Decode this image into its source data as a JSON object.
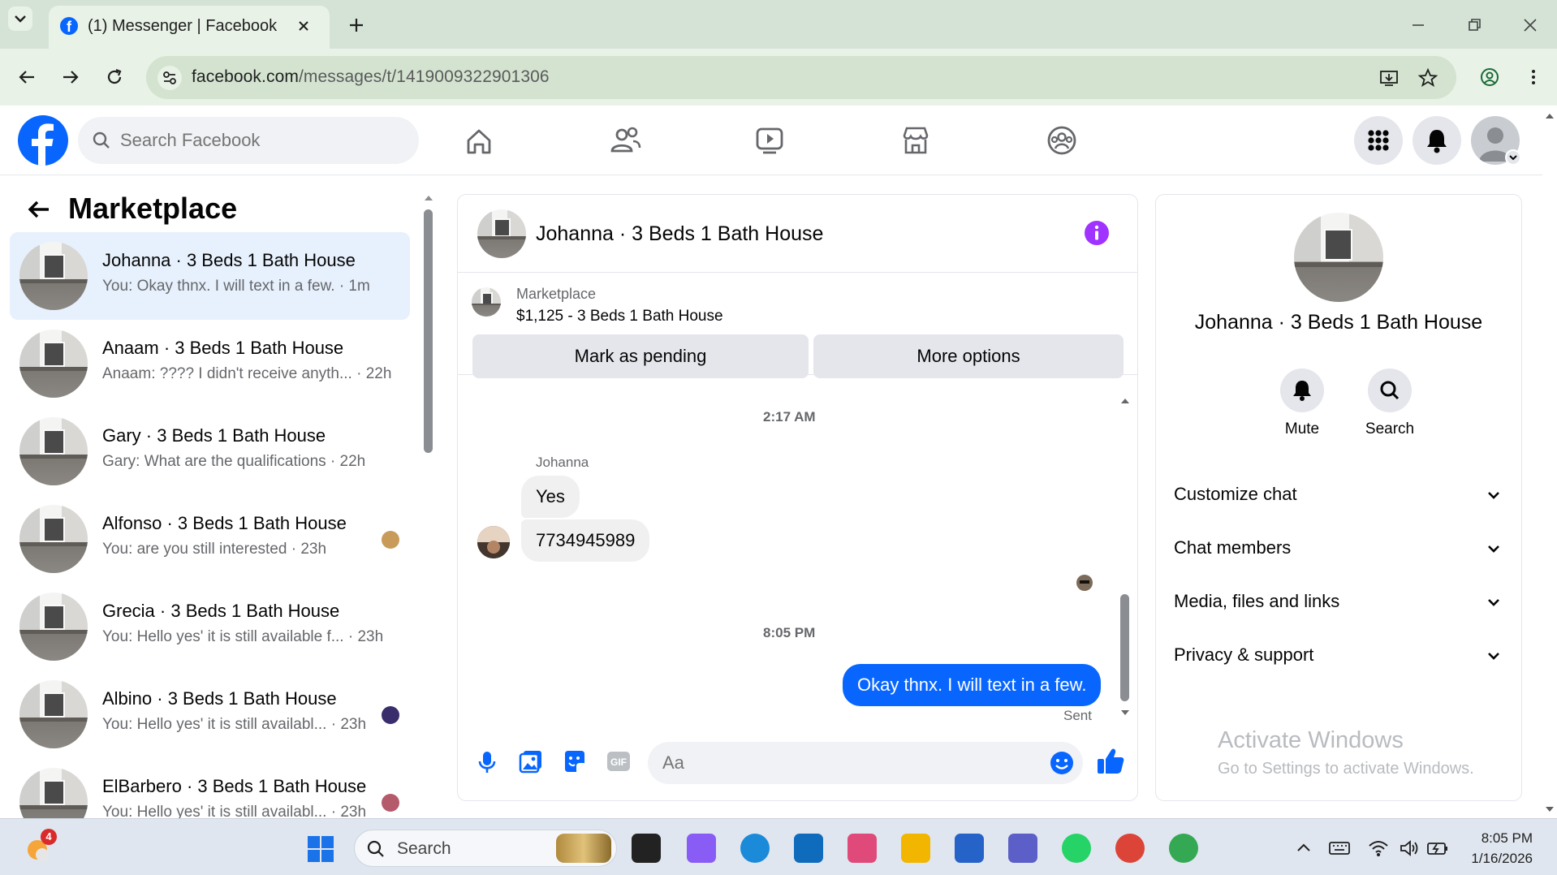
{
  "browser": {
    "tab_title": "(1) Messenger | Facebook",
    "url_host": "facebook.com",
    "url_path": "/messages/t/1419009322901306",
    "icons": [
      "tab-list-icon",
      "facebook-favicon",
      "close-tab-icon",
      "new-tab-icon",
      "minimize-icon",
      "restore-icon",
      "close-window-icon",
      "back-icon",
      "forward-icon",
      "reload-icon",
      "site-info-icon",
      "install-app-icon",
      "bookmark-star-icon",
      "profile-icon",
      "menu-kebab-icon"
    ]
  },
  "fb_header": {
    "search_placeholder": "Search Facebook",
    "nav_icons": [
      "home-icon",
      "friends-icon",
      "watch-icon",
      "marketplace-icon",
      "groups-icon"
    ],
    "right_icons": [
      "menu-grid-icon",
      "notifications-bell-icon",
      "account-avatar-icon"
    ],
    "brand_color": "#0866ff"
  },
  "left_panel": {
    "title": "Marketplace",
    "conversations": [
      {
        "name": "Johanna · 3 Beds 1 Bath House",
        "preview": "You: Okay thnx. I will text in a few. · 1m",
        "active": true
      },
      {
        "name": "Anaam · 3 Beds 1 Bath House",
        "preview": "Anaam: ???? I didn't receive anyth... · 22h"
      },
      {
        "name": "Gary · 3 Beds 1 Bath House",
        "preview": "Gary: What are the qualifications · 22h"
      },
      {
        "name": "Alfonso · 3 Beds 1 Bath House",
        "preview": "You: are you still interested · 23h"
      },
      {
        "name": "Grecia · 3 Beds 1 Bath House",
        "preview": "You: Hello yes' it is still available f... · 23h"
      },
      {
        "name": "Albino · 3 Beds 1 Bath House",
        "preview": "You: Hello yes' it is still availabl... · 23h"
      },
      {
        "name": "ElBarbero · 3 Beds 1 Bath House",
        "preview": "You: Hello yes' it is still availabl... · 23h"
      }
    ]
  },
  "chat": {
    "header_name": "Johanna · 3 Beds 1 Bath House",
    "listing_label": "Marketplace",
    "listing_title": "$1,125 - 3 Beds 1 Bath House",
    "mark_pending_label": "Mark as pending",
    "more_options_label": "More options",
    "time_1": "2:17 AM",
    "sender_name": "Johanna",
    "msg_1": "Yes",
    "msg_2": "7734945989",
    "time_2": "8:05 PM",
    "msg_out": "Okay thnx. I will text in a few.",
    "status": "Sent",
    "composer_placeholder": "Aa",
    "composer_icons": [
      "microphone-icon",
      "photo-icon",
      "sticker-icon",
      "gif-icon",
      "emoji-icon",
      "thumbs-up-icon"
    ],
    "info_icon_color": "#a033ff"
  },
  "info_panel": {
    "name": "Johanna · 3 Beds 1 Bath House",
    "mute_label": "Mute",
    "search_label": "Search",
    "sections": [
      "Customize chat",
      "Chat members",
      "Media, files and links",
      "Privacy & support"
    ],
    "watermark_title": "Activate Windows",
    "watermark_sub": "Go to Settings to activate Windows."
  },
  "taskbar": {
    "search_label": "Search",
    "time": "8:05 PM",
    "date": "1/16/2026",
    "weather_badge": "4"
  }
}
